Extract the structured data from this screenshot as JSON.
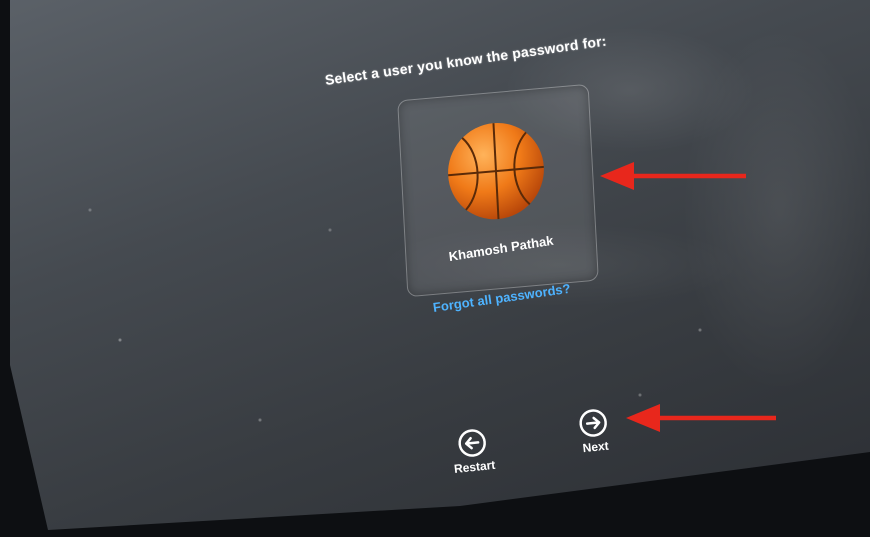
{
  "login": {
    "prompt": "Select a user you know the password for:",
    "user": {
      "name": "Khamosh Pathak",
      "avatar_icon": "basketball-icon"
    },
    "forgot_link": "Forgot all passwords?"
  },
  "nav": {
    "restart_label": "Restart",
    "restart_icon": "arrow-left-circle-icon",
    "next_label": "Next",
    "next_icon": "arrow-right-circle-icon"
  },
  "annotation_colors": {
    "arrow": "#e8271c"
  },
  "colors": {
    "link": "#4eb3ff",
    "screen": "#45494f"
  }
}
